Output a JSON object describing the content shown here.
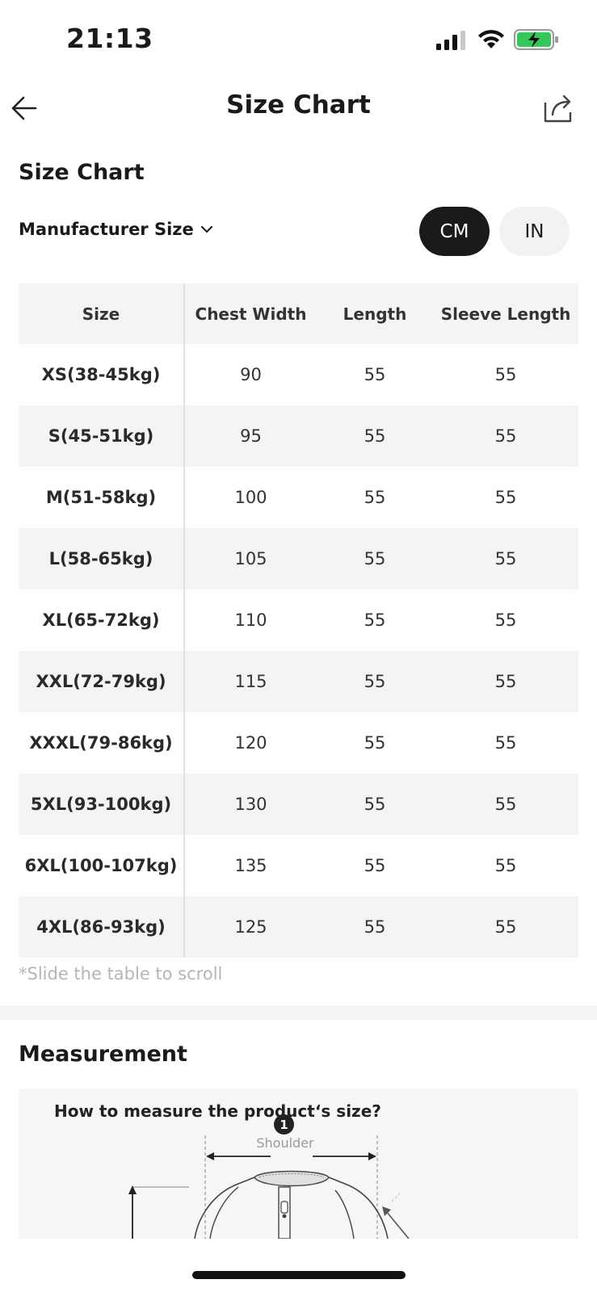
{
  "status_bar": {
    "time": "21:13"
  },
  "nav": {
    "title": "Size Chart"
  },
  "size_chart": {
    "heading": "Size Chart",
    "dropdown_label": "Manufacturer Size",
    "units": {
      "cm": "CM",
      "in": "IN",
      "selected": "CM"
    },
    "headers": [
      "Size",
      "Chest Width",
      "Length",
      "Sleeve Length"
    ],
    "rows": [
      [
        "XS(38-45kg)",
        "90",
        "55",
        "55"
      ],
      [
        "S(45-51kg)",
        "95",
        "55",
        "55"
      ],
      [
        "M(51-58kg)",
        "100",
        "55",
        "55"
      ],
      [
        "L(58-65kg)",
        "105",
        "55",
        "55"
      ],
      [
        "XL(65-72kg)",
        "110",
        "55",
        "55"
      ],
      [
        "XXL(72-79kg)",
        "115",
        "55",
        "55"
      ],
      [
        "XXXL(79-86kg)",
        "120",
        "55",
        "55"
      ],
      [
        "5XL(93-100kg)",
        "130",
        "55",
        "55"
      ],
      [
        "6XL(100-107kg)",
        "135",
        "55",
        "55"
      ],
      [
        "4XL(86-93kg)",
        "125",
        "55",
        "55"
      ]
    ],
    "scroll_hint": "*Slide the table to scroll"
  },
  "measurement": {
    "heading": "Measurement",
    "question": "How to measure the product‘s size?",
    "marker_number": "1",
    "marker_label": "Shoulder"
  },
  "colors": {
    "selected_toggle": "#1a1a1a",
    "unselected_toggle": "#f2f2f2",
    "battery_fill": "#34c759"
  }
}
